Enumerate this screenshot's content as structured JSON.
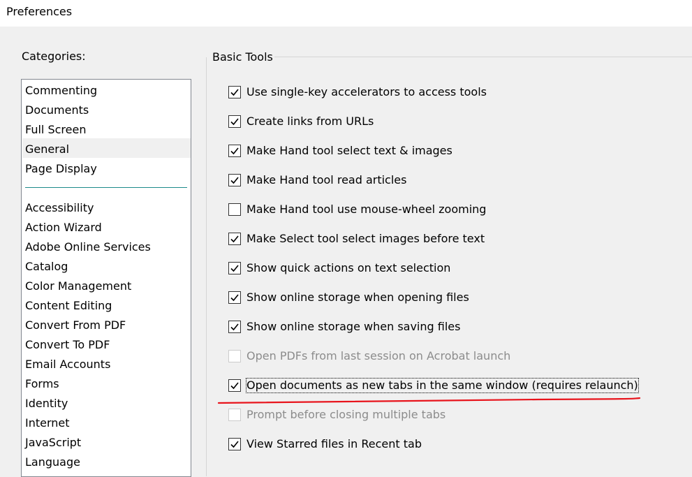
{
  "window": {
    "title": "Preferences"
  },
  "categories": {
    "label": "Categories:",
    "selected": "General",
    "top_items": [
      "Commenting",
      "Documents",
      "Full Screen",
      "General",
      "Page Display"
    ],
    "items": [
      "Accessibility",
      "Action Wizard",
      "Adobe Online Services",
      "Catalog",
      "Color Management",
      "Content Editing",
      "Convert From PDF",
      "Convert To PDF",
      "Email Accounts",
      "Forms",
      "Identity",
      "Internet",
      "JavaScript",
      "Language"
    ]
  },
  "basic_tools": {
    "title": "Basic Tools",
    "options": [
      {
        "label": "Use single-key accelerators to access tools",
        "checked": true,
        "enabled": true
      },
      {
        "label": "Create links from URLs",
        "checked": true,
        "enabled": true
      },
      {
        "label": "Make Hand tool select text & images",
        "checked": true,
        "enabled": true
      },
      {
        "label": "Make Hand tool read articles",
        "checked": true,
        "enabled": true
      },
      {
        "label": "Make Hand tool use mouse-wheel zooming",
        "checked": false,
        "enabled": true
      },
      {
        "label": "Make Select tool select images before text",
        "checked": true,
        "enabled": true
      },
      {
        "label": "Show quick actions on text selection",
        "checked": true,
        "enabled": true
      },
      {
        "label": "Show online storage when opening files",
        "checked": true,
        "enabled": true
      },
      {
        "label": "Show online storage when saving files",
        "checked": true,
        "enabled": true
      },
      {
        "label": "Open PDFs from last session on Acrobat launch",
        "checked": false,
        "enabled": false
      },
      {
        "label": "Open documents as new tabs in the same window (requires relaunch)",
        "checked": true,
        "enabled": true,
        "focused": true
      },
      {
        "label": "Prompt before closing multiple tabs",
        "checked": false,
        "enabled": false
      },
      {
        "label": "View Starred files in Recent tab",
        "checked": true,
        "enabled": true
      }
    ]
  },
  "colors": {
    "annotation": "#e8141c",
    "disabled_text": "#8c8c8c"
  }
}
